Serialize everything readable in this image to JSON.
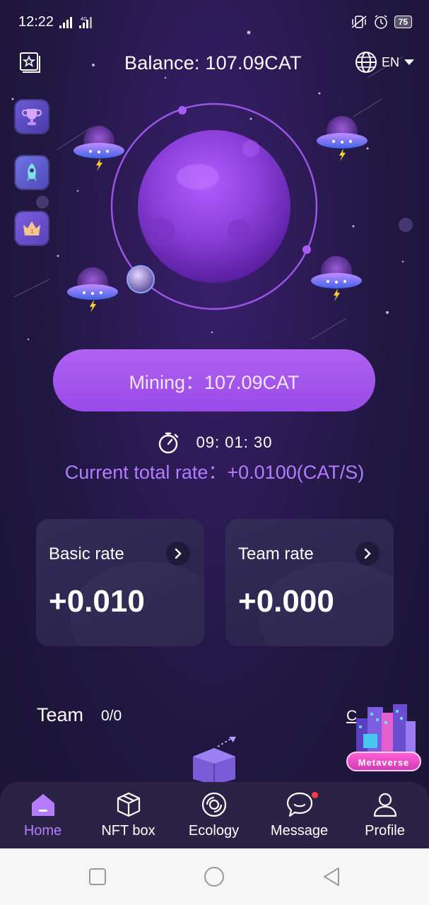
{
  "status_bar": {
    "time": "12:22",
    "network": "4G",
    "battery": "75"
  },
  "header": {
    "balance": "Balance: 107.09CAT",
    "language": "EN"
  },
  "side_icons": [
    "trophy-icon",
    "rocket-icon",
    "crown-icon"
  ],
  "mining": {
    "label": "Mining：107.09CAT"
  },
  "timer": {
    "value": "09: 01: 30"
  },
  "total_rate": {
    "text": "Current total rate：+0.0100(CAT/S)"
  },
  "rates": [
    {
      "title": "Basic rate",
      "value": "+0.010"
    },
    {
      "title": "Team rate",
      "value": "+0.000"
    }
  ],
  "team": {
    "label": "Team",
    "count": "0/0",
    "more": "C"
  },
  "metaverse": {
    "label": "Metaverse"
  },
  "nav": [
    {
      "label": "Home",
      "icon": "home-icon",
      "active": true
    },
    {
      "label": "NFT box",
      "icon": "cube-icon",
      "active": false
    },
    {
      "label": "Ecology",
      "icon": "ecology-icon",
      "active": false
    },
    {
      "label": "Message",
      "icon": "chat-icon",
      "active": false
    },
    {
      "label": "Profile",
      "icon": "person-icon",
      "active": false
    }
  ],
  "colors": {
    "accent": "#b57cff",
    "button": "#a855f0",
    "nav_bg": "#2a2346",
    "bg": "#1f1740"
  }
}
